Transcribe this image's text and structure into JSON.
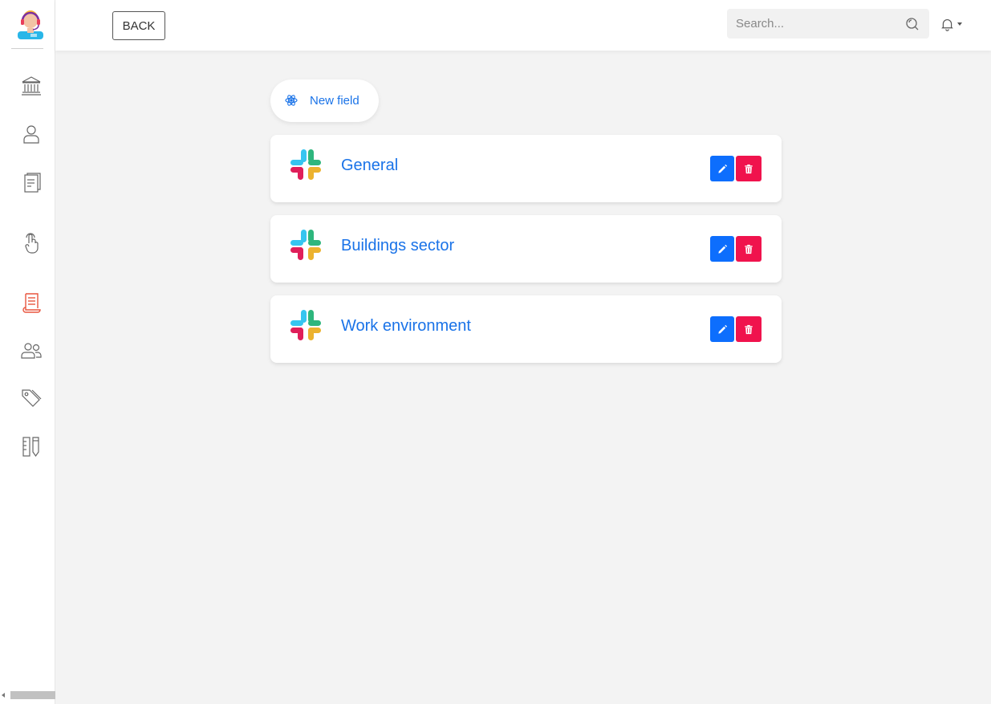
{
  "toolbar": {
    "back_label": "BACK"
  },
  "search": {
    "placeholder": "Search..."
  },
  "sidebar": {
    "items": [
      {
        "icon": "bank-icon",
        "active": false
      },
      {
        "icon": "user-icon",
        "active": false
      },
      {
        "icon": "document-icon",
        "active": false
      },
      {
        "icon": "touch-icon",
        "active": false
      },
      {
        "icon": "scroll-icon",
        "active": true
      },
      {
        "icon": "users-icon",
        "active": false
      },
      {
        "icon": "tags-icon",
        "active": false
      },
      {
        "icon": "ruler-pencil-icon",
        "active": false
      }
    ]
  },
  "main": {
    "new_field_label": "New field",
    "fields": [
      {
        "title": "General"
      },
      {
        "title": "Buildings sector"
      },
      {
        "title": "Work environment"
      }
    ]
  },
  "colors": {
    "accent": "#1a73e8",
    "edit": "#0d6efd",
    "delete": "#f0134d",
    "active_nav": "#e8553e"
  }
}
